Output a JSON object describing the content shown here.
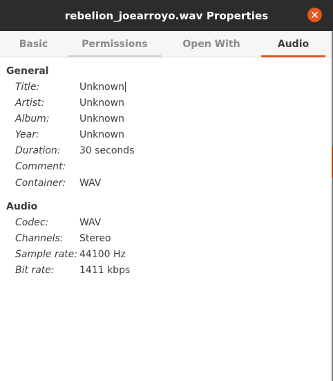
{
  "window": {
    "title": "rebelion_joearroyo.wav Properties",
    "accent_color": "#e95420",
    "close_icon": "close-icon"
  },
  "tabs": [
    {
      "label": "Basic",
      "active": false
    },
    {
      "label": "Permissions",
      "active": false
    },
    {
      "label": "Open With",
      "active": false
    },
    {
      "label": "Audio",
      "active": true
    }
  ],
  "general": {
    "heading": "General",
    "rows": [
      {
        "label": "Title:",
        "value": "Unknown"
      },
      {
        "label": "Artist:",
        "value": "Unknown"
      },
      {
        "label": "Album:",
        "value": "Unknown"
      },
      {
        "label": "Year:",
        "value": "Unknown"
      },
      {
        "label": "Duration:",
        "value": "30 seconds"
      },
      {
        "label": "Comment:",
        "value": ""
      },
      {
        "label": "Container:",
        "value": "WAV"
      }
    ]
  },
  "audio": {
    "heading": "Audio",
    "rows": [
      {
        "label": "Codec:",
        "value": "WAV"
      },
      {
        "label": "Channels:",
        "value": "Stereo"
      },
      {
        "label": "Sample rate:",
        "value": "44100 Hz"
      },
      {
        "label": "Bit rate:",
        "value": "1411 kbps"
      }
    ]
  }
}
